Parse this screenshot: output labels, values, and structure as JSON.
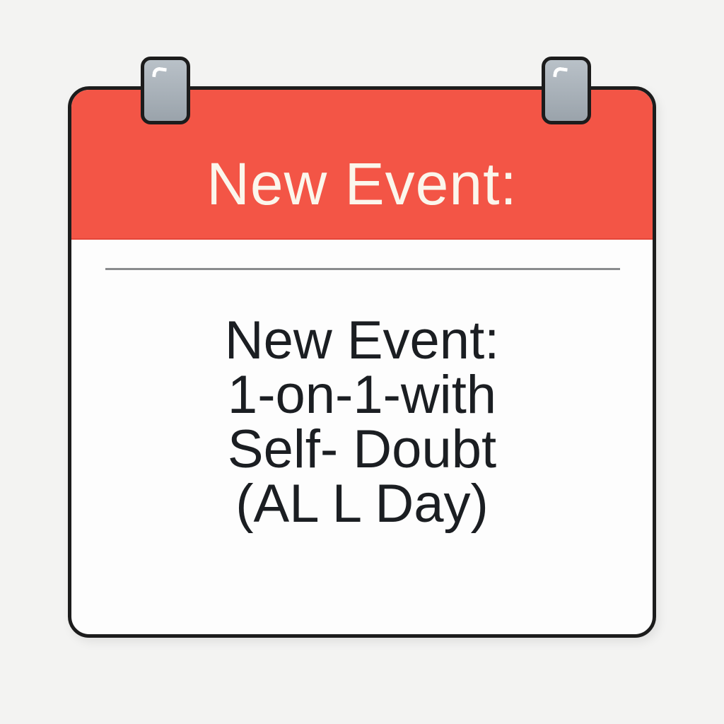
{
  "calendar": {
    "header_title": "New Event:",
    "event_lines": [
      "New Event:",
      "1-on-1-with",
      "Self- Doubt",
      "(AL L Day)"
    ],
    "colors": {
      "header": "#f35546",
      "header_text": "#fbf6ec",
      "body_text": "#1b1e22",
      "ring": "#9aa3ab"
    }
  }
}
